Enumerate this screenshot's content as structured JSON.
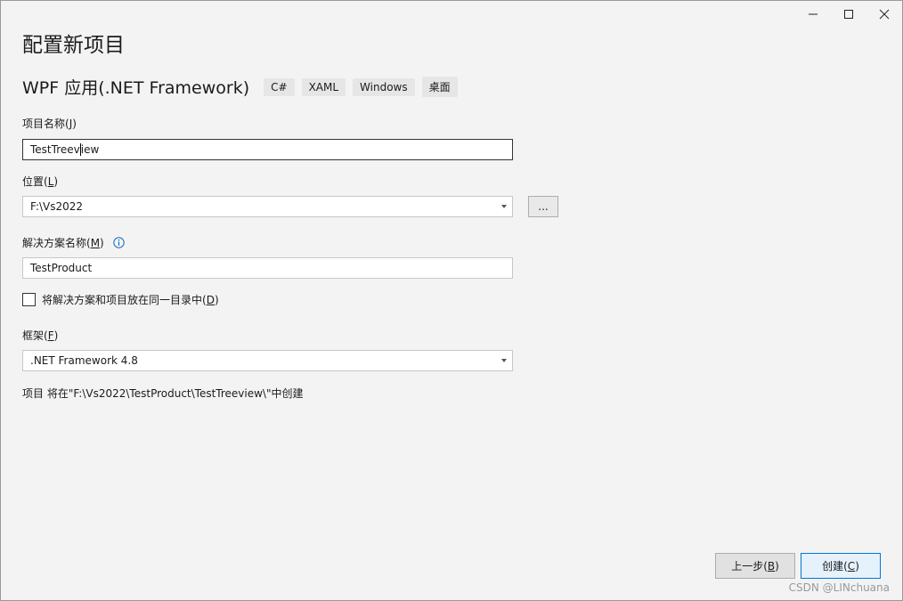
{
  "window": {
    "controls": [
      "minimize-icon",
      "maximize-icon",
      "close-icon"
    ]
  },
  "header": {
    "title": "配置新项目",
    "template_name": "WPF 应用(.NET Framework)",
    "tags": [
      "C#",
      "XAML",
      "Windows",
      "桌面"
    ]
  },
  "form": {
    "project_name_label_text": "项目名称(",
    "project_name_label_key": "J",
    "project_name_label_end": ")",
    "project_name_value_before": "TestTreev",
    "project_name_value_after": "iew",
    "location_label_text": "位置(",
    "location_label_key": "L",
    "location_label_end": ")",
    "location_value": "F:\\Vs2022",
    "browse_label": "...",
    "solution_name_label_text": "解决方案名称(",
    "solution_name_label_key": "M",
    "solution_name_label_end": ")",
    "solution_name_value": "TestProduct",
    "same_dir_label_text": "将解决方案和项目放在同一目录中(",
    "same_dir_label_key": "D",
    "same_dir_label_end": ")",
    "same_dir_checked": false,
    "framework_label_text": "框架(",
    "framework_label_key": "F",
    "framework_label_end": ")",
    "framework_value": ".NET Framework 4.8",
    "summary": "项目 将在\"F:\\Vs2022\\TestProduct\\TestTreeview\\\"中创建"
  },
  "footer": {
    "back_label_text": "上一步(",
    "back_label_key": "B",
    "back_label_end": ")",
    "create_label_text": "创建(",
    "create_label_key": "C",
    "create_label_end": ")"
  },
  "watermark": "CSDN @LINchuana",
  "colors": {
    "accent": "#0078d4",
    "background": "#f3f3f3",
    "input_background": "#ffffff",
    "info_icon": "#0f6cbd"
  }
}
